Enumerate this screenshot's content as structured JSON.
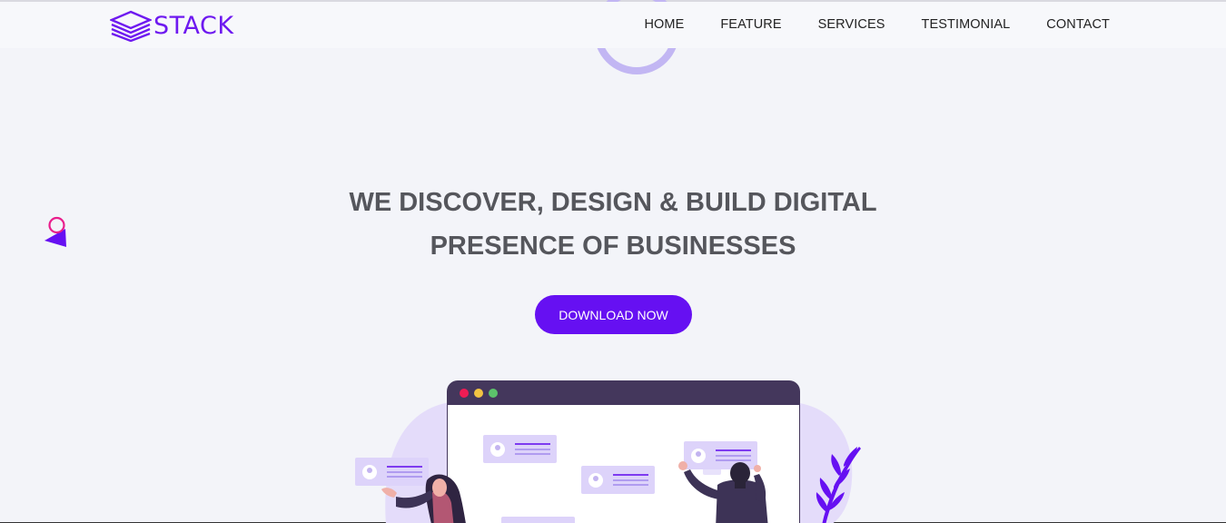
{
  "brand": {
    "name": "STACK",
    "accent": "#6e19f0"
  },
  "nav": {
    "items": [
      {
        "label": "HOME"
      },
      {
        "label": "FEATURE"
      },
      {
        "label": "SERVICES"
      },
      {
        "label": "TESTIMONIAL"
      },
      {
        "label": "CONTACT"
      }
    ]
  },
  "hero": {
    "title_line1": "WE DISCOVER, DESIGN & BUILD DIGITAL",
    "title_line2": "PRESENCE OF BUSINESSES",
    "cta_label": "DOWNLOAD NOW",
    "cta_color": "#6610f2"
  },
  "icons": {
    "logo": "stack-layers-icon",
    "window_close": "red-dot-icon",
    "window_minimize": "yellow-dot-icon",
    "window_maximize": "green-dot-icon",
    "profile_card": "profile-card-icon",
    "plant": "leaf-plant-icon"
  },
  "colors": {
    "page_bg": "#f3f4f9",
    "title": "#55565c",
    "browser_bar": "#44375c",
    "blob": "#e4dcfa",
    "decor_ring": "#c2b6f3"
  }
}
